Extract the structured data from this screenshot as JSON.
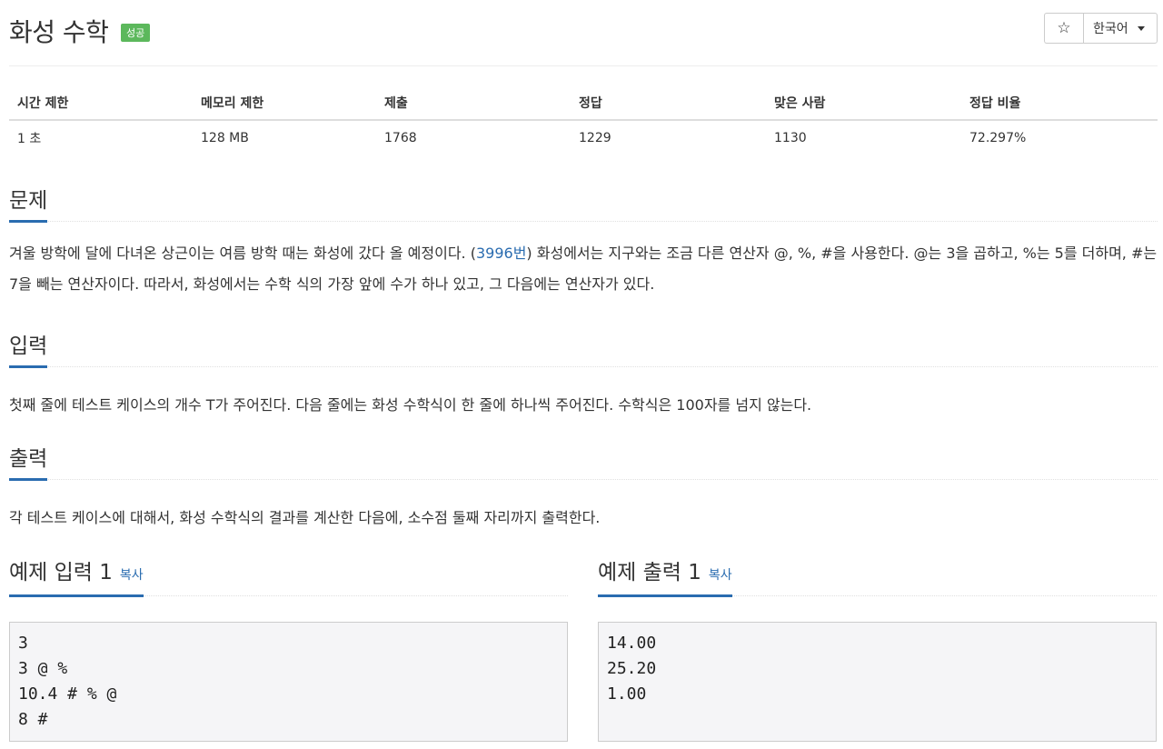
{
  "problem": {
    "title": "화성 수학",
    "status_badge": "성공",
    "star_icon": "☆",
    "language": "한국어"
  },
  "info_table": {
    "headers": [
      "시간 제한",
      "메모리 제한",
      "제출",
      "정답",
      "맞은 사람",
      "정답 비율"
    ],
    "values": [
      "1 초",
      "128 MB",
      "1768",
      "1229",
      "1130",
      "72.297%"
    ]
  },
  "sections": {
    "problem": {
      "title": "문제",
      "text_before_link": "겨울 방학에 달에 다녀온 상근이는 여름 방학 때는 화성에 갔다 올 예정이다. (",
      "link_text": "3996번",
      "text_after_link": ") 화성에서는 지구와는 조금 다른 연산자 @, %, #을 사용한다. @는 3을 곱하고, %는 5를 더하며, #는 7을 빼는 연산자이다. 따라서, 화성에서는 수학 식의 가장 앞에 수가 하나 있고, 그 다음에는 연산자가 있다."
    },
    "input": {
      "title": "입력",
      "text": "첫째 줄에 테스트 케이스의 개수 T가 주어진다. 다음 줄에는 화성 수학식이 한 줄에 하나씩 주어진다. 수학식은 100자를 넘지 않는다."
    },
    "output": {
      "title": "출력",
      "text": "각 테스트 케이스에 대해서, 화성 수학식의 결과를 계산한 다음에, 소수점 둘째 자리까지 출력한다."
    }
  },
  "samples": {
    "input": {
      "title": "예제 입력 1",
      "copy_label": "복사",
      "content": "3\n3 @ %\n10.4 # % @\n8 #"
    },
    "output": {
      "title": "예제 출력 1",
      "copy_label": "복사",
      "content": "14.00\n25.20\n1.00"
    }
  },
  "colors": {
    "accent": "#2a6cb0",
    "success_badge": "#5cb85c"
  }
}
